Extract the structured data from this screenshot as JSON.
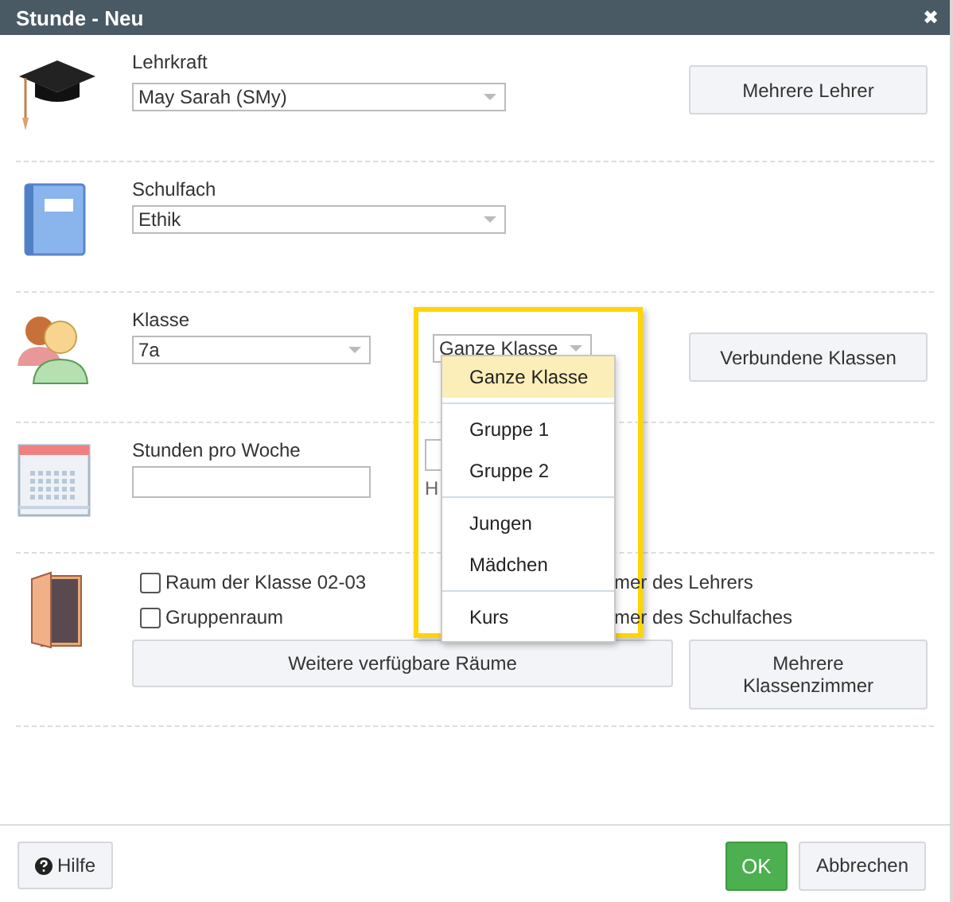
{
  "window": {
    "title": "Stunde - Neu",
    "close": "✖"
  },
  "teacher": {
    "label": "Lehrkraft",
    "value": "May Sarah (SMy)",
    "button": "Mehrere Lehrer"
  },
  "subject": {
    "label": "Schulfach",
    "value": "Ethik"
  },
  "class": {
    "label": "Klasse",
    "value": "7a",
    "group_select": "Ganze Klasse",
    "button": "Verbundene Klassen"
  },
  "hours": {
    "label": "Stunden pro Woche",
    "partial_hint": "H"
  },
  "rooms": {
    "checkboxes": [
      {
        "label": "Raum der Klasse 02-03",
        "checked": false
      },
      {
        "label": "Gruppenraum",
        "checked": false
      }
    ],
    "partial_labels": [
      "mer des Lehrers",
      "mer des Schulfaches"
    ],
    "more_rooms_button": "Weitere verfügbare Räume",
    "multi_rooms_button": "Mehrere Klassenzimmer"
  },
  "group_dropdown": {
    "groups": [
      {
        "items": [
          {
            "label": "Ganze Klasse",
            "selected": true
          }
        ]
      },
      {
        "items": [
          {
            "label": "Gruppe 1",
            "selected": false
          },
          {
            "label": "Gruppe 2",
            "selected": false
          }
        ]
      },
      {
        "items": [
          {
            "label": "Jungen",
            "selected": false
          },
          {
            "label": "Mädchen",
            "selected": false
          }
        ]
      },
      {
        "items": [
          {
            "label": "Kurs",
            "selected": false
          }
        ]
      }
    ]
  },
  "footer": {
    "help": "Hilfe",
    "ok": "OK",
    "cancel": "Abbrechen"
  }
}
